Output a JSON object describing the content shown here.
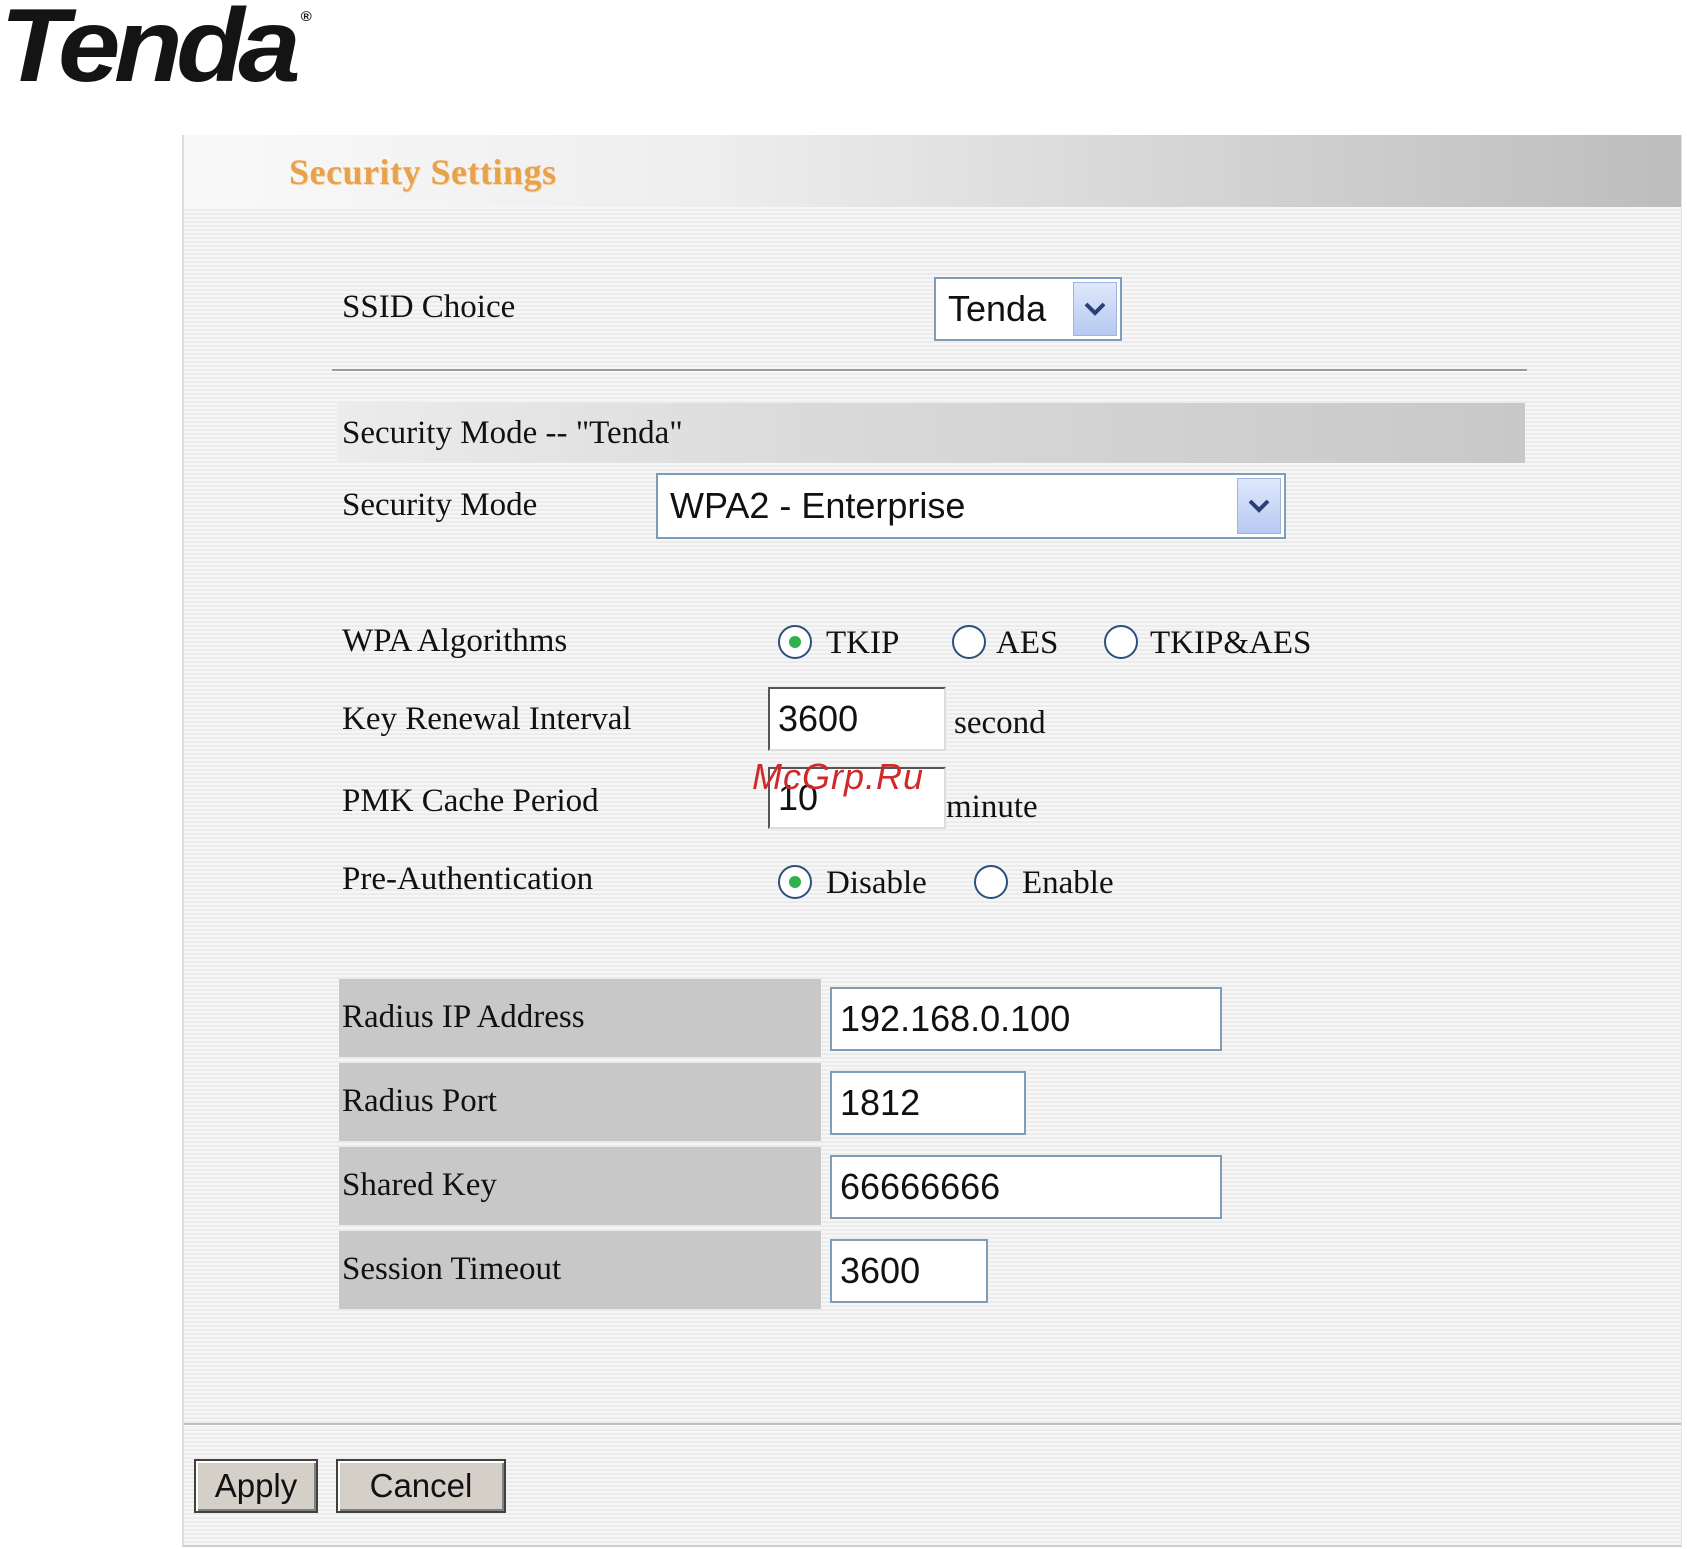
{
  "brand": {
    "logo_text": "Tenda",
    "logo_mark": "®"
  },
  "page": {
    "title": "Security Settings"
  },
  "ssid": {
    "label": "SSID Choice",
    "selected": "Tenda"
  },
  "security": {
    "section_title": "Security Mode -- \"Tenda\"",
    "mode_label": "Security Mode",
    "mode_selected": "WPA2 - Enterprise"
  },
  "wpa": {
    "algorithms_label": "WPA Algorithms",
    "algorithms": [
      {
        "label": "TKIP",
        "checked": true
      },
      {
        "label": "AES",
        "checked": false
      },
      {
        "label": "TKIP&AES",
        "checked": false
      }
    ],
    "key_renewal_label": "Key Renewal Interval",
    "key_renewal_value": "3600",
    "key_renewal_unit": "second",
    "pmk_label": "PMK Cache Period",
    "pmk_value": "10",
    "pmk_unit": "minute",
    "preauth_label": "Pre-Authentication",
    "preauth_options": [
      {
        "label": "Disable",
        "checked": true
      },
      {
        "label": "Enable",
        "checked": false
      }
    ]
  },
  "radius": {
    "ip_label": "Radius IP Address",
    "ip_value": "192.168.0.100",
    "port_label": "Radius Port",
    "port_value": "1812",
    "key_label": "Shared Key",
    "key_value": "66666666",
    "timeout_label": "Session Timeout",
    "timeout_value": "3600"
  },
  "buttons": {
    "apply": "Apply",
    "cancel": "Cancel"
  },
  "watermark": "McGrp.Ru",
  "colors": {
    "title": "#e8a24e",
    "radio_dot": "#2db14a",
    "input_border": "#7f9db9",
    "watermark": "#cf2a2a"
  }
}
